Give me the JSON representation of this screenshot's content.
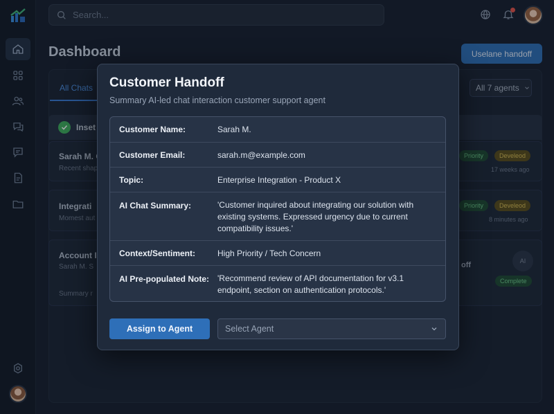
{
  "search": {
    "placeholder": "Search..."
  },
  "page": {
    "title": "Dashboard",
    "handoff_button": "Uselane handoff"
  },
  "tabs": {
    "active_label": "All Chats"
  },
  "filter": {
    "label": "All 7 agents"
  },
  "list": {
    "header": "Inset",
    "rows": [
      {
        "title": "Sarah M. C",
        "sub": "Recent shap",
        "badges": [
          "Priority",
          "Develeod"
        ],
        "time": "17 weeks ago"
      },
      {
        "title": "Integrati",
        "sub": "Momest aut",
        "badges": [
          "Priority",
          "Develeod"
        ],
        "time": "8 minutes ago"
      },
      {
        "title": "Account I",
        "sub": "Sarah M. S",
        "sub2": "Summary r",
        "fragment": "off",
        "circle": "AI",
        "badges": [
          "Complete"
        ]
      }
    ]
  },
  "modal": {
    "title": "Customer Handoff",
    "subtitle": "Summary AI-led chat interaction customer support agent",
    "fields": [
      {
        "label": "Customer Name:",
        "value": "Sarah M."
      },
      {
        "label": "Customer Email:",
        "value": "sarah.m@example.com"
      },
      {
        "label": "Topic:",
        "value": "Enterprise Integration - Product X"
      },
      {
        "label": "AI Chat Summary:",
        "value": "'Customer inquired about integrating our solution with existing systems. Expressed urgency due to current compatibility issues.'"
      },
      {
        "label": "Context/Sentiment:",
        "value": "High Priority / Tech Concern"
      },
      {
        "label": "AI Pre-populated Note:",
        "value": "'Recommend review of API documentation for v3.1 endpoint, section on authentication protocols.'"
      }
    ],
    "assign_button": "Assign to Agent",
    "select_placeholder": "Select Agent"
  },
  "colors": {
    "accent": "#2e6fb8",
    "success": "#3fae5c",
    "warning": "#d9be54",
    "alert": "#e5534b"
  },
  "icons": [
    "logo-icon",
    "home-icon",
    "grid-icon",
    "users-icon",
    "chat-icon",
    "message-icon",
    "document-icon",
    "folder-icon",
    "settings-icon",
    "search-icon",
    "globe-icon",
    "bell-icon",
    "chevron-down-icon",
    "check-icon"
  ]
}
